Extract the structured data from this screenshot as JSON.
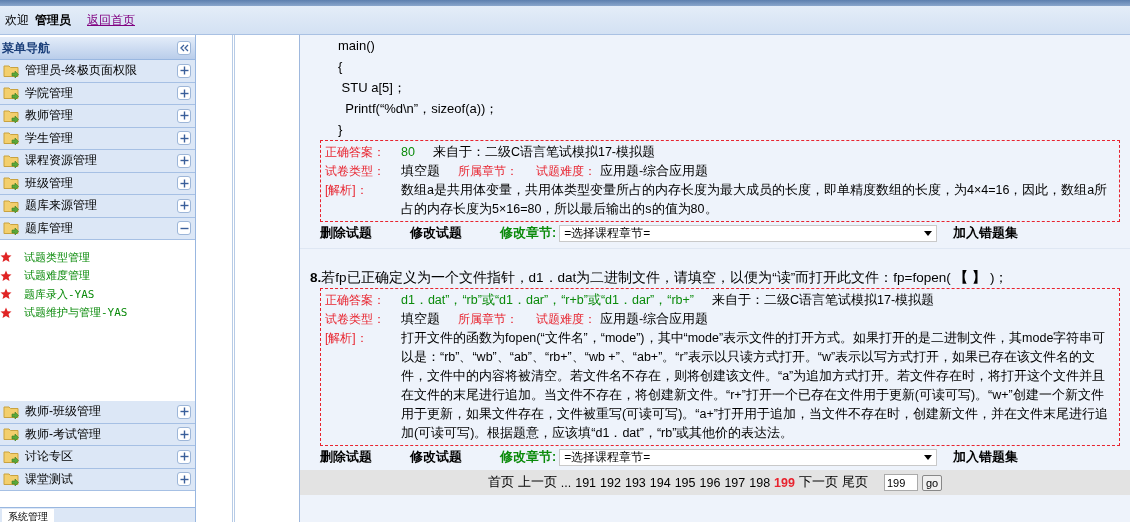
{
  "header": {
    "greeting": "欢迎",
    "user": "管理员",
    "home_link": "返回首页"
  },
  "sidebar": {
    "title": "菜单导航",
    "items": [
      {
        "label": "管理员-终极页面权限",
        "expanded": false
      },
      {
        "label": "学院管理",
        "expanded": false
      },
      {
        "label": "教师管理",
        "expanded": false
      },
      {
        "label": "学生管理",
        "expanded": false
      },
      {
        "label": "课程资源管理",
        "expanded": false
      },
      {
        "label": "班级管理",
        "expanded": false
      },
      {
        "label": "题库来源管理",
        "expanded": false
      },
      {
        "label": "题库管理",
        "expanded": true,
        "children": [
          "试题类型管理",
          "试题难度管理",
          "题库录入-YAS",
          "试题维护与管理-YAS"
        ]
      },
      {
        "label": "教师-班级管理",
        "expanded": false
      },
      {
        "label": "教师-考试管理",
        "expanded": false
      },
      {
        "label": "讨论专区",
        "expanded": false
      },
      {
        "label": "课堂测试",
        "expanded": false
      }
    ],
    "bottom_tab": "系统管理"
  },
  "questions": [
    {
      "code_lines": [
        "main()",
        "{",
        " STU a[5]；",
        "  Printf(“%d\\n”，sizeof(a))；",
        "}"
      ],
      "answer_label": "正确答案：",
      "answer": "80",
      "source": "来自于：二级C语言笔试模拟17-模拟题",
      "type_label": "试卷类型：",
      "type": "填空题",
      "chapter_label": "所属章节：",
      "difficulty_label": "试题难度：",
      "difficulty": "应用题-综合应用题",
      "analysis_label": "[解析]：",
      "analysis": "数组a是共用体变量，共用体类型变量所占的内存长度为最大成员的长度，即单精度数组的长度，为4×4=16，因此，数组a所占的内存长度为5×16=80，所以最后输出的s的值为80。",
      "actions": {
        "delete": "删除试题",
        "edit": "修改试题",
        "chapter_select_label": "修改章节:",
        "chapter_select": "=选择课程章节=",
        "add_wrong": "加入错题集"
      }
    },
    {
      "number": "8.",
      "text": "若fp已正确定义为一个文件指针，d1．dat为二进制文件，请填空，以便为“读”而打开此文件：fp=fopen(  **【 】**  )；",
      "answer_label": "正确答案：",
      "answer": "d1．dat”，“rb”或“d1．dar”，“r+b”或“d1．dar”，“rb+”",
      "source": "来自于：二级C语言笔试模拟17-模拟题",
      "type_label": "试卷类型：",
      "type": "填空题",
      "chapter_label": "所属章节：",
      "difficulty_label": "试题难度：",
      "difficulty": "应用题-综合应用题",
      "analysis_label": "[解析]：",
      "analysis": "打开文件的函数为fopen(“文件名”，“mode”)，其中“mode”表示文件的打开方式。如果打开的是二进制文件，其mode字符串可以是：“rb”、“wb”、“ab”、“rb+”、“wb +”、“ab+”。“r”表示以只读方式打开。“w”表示以写方式打开，如果已存在该文件名的文件，文件中的内容将被清空。若文件名不存在，则将创建该文件。“a”为追加方式打开。若文件存在时，将打开这个文件并且在文件的末尾进行追加。当文件不存在，将创建新文件。“r+”打开一个已存在文件用于更新(可读可写)。“w+”创建一个新文件用于更新，如果文件存在，文件被重写(可读可写)。“a+”打开用于追加，当文件不存在时，创建新文件，并在文件末尾进行追加(可读可写)。根据题意，应该填“d1．dat”，“rb”或其他价的表达法。",
      "actions": {
        "delete": "删除试题",
        "edit": "修改试题",
        "chapter_select_label": "修改章节:",
        "chapter_select": "=选择课程章节=",
        "add_wrong": "加入错题集"
      }
    }
  ],
  "pagination": {
    "first": "首页",
    "prev": "上一页",
    "ellipsis": "...",
    "pages": [
      {
        "label": "191",
        "selected": false
      },
      {
        "label": "192",
        "selected": false
      },
      {
        "label": "193",
        "selected": false
      },
      {
        "label": "194",
        "selected": false
      },
      {
        "label": "195",
        "selected": false
      },
      {
        "label": "196",
        "selected": false
      },
      {
        "label": "197",
        "selected": false
      },
      {
        "label": "198",
        "selected": false
      },
      {
        "label": "199",
        "selected": true
      }
    ],
    "next": "下一页",
    "last": "尾页",
    "page_input": "199",
    "go": "go"
  }
}
